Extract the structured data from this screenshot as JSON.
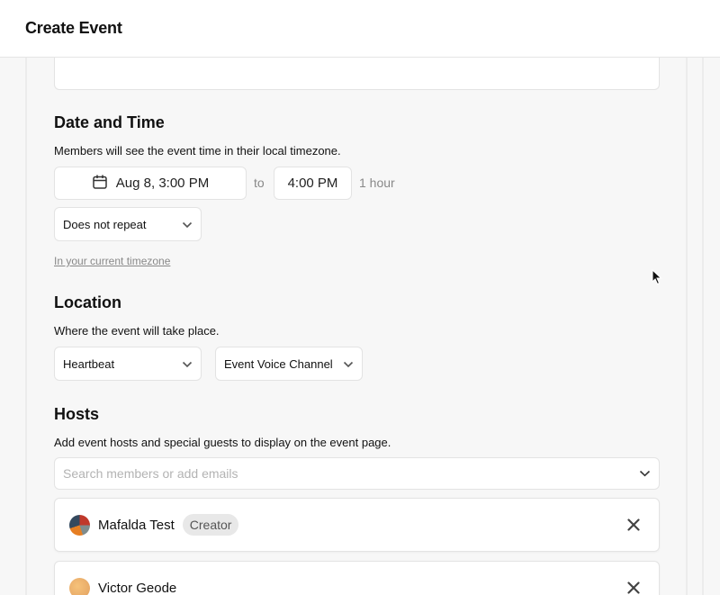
{
  "header": {
    "title": "Create Event"
  },
  "date_time": {
    "title": "Date and Time",
    "description": "Members will see the event time in their local timezone.",
    "start": "Aug 8, 3:00 PM",
    "to_label": "to",
    "end": "4:00 PM",
    "duration": "1 hour",
    "repeat": "Does not repeat",
    "timezone_link": "In your current timezone"
  },
  "location": {
    "title": "Location",
    "description": "Where the event will take place.",
    "server": "Heartbeat",
    "channel": "Event Voice Channel"
  },
  "hosts": {
    "title": "Hosts",
    "description": "Add event hosts and special guests to display on the event page.",
    "search_placeholder": "Search members or add emails",
    "items": [
      {
        "name": "Mafalda Test",
        "badge": "Creator"
      },
      {
        "name": "Victor Geode"
      }
    ]
  },
  "icons": {
    "calendar": "calendar-icon",
    "chevron": "chevron-down-icon",
    "close": "close-icon",
    "cursor": "mouse-cursor-icon"
  }
}
